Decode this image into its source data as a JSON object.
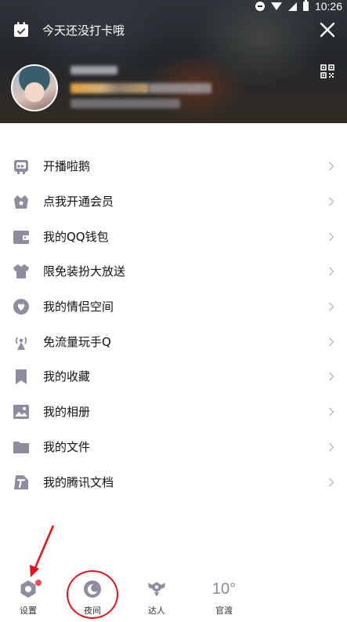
{
  "status_bar": {
    "time": "10:26"
  },
  "header": {
    "checkin_text": "今天还没打卡哦",
    "icons": {
      "checkin": "calendar-check-icon",
      "close": "close-icon",
      "qr": "qr-code-icon"
    }
  },
  "menu": {
    "items": [
      {
        "label": "开播啦鹅",
        "icon": "live-icon"
      },
      {
        "label": "点我开通会员",
        "icon": "vip-icon"
      },
      {
        "label": "我的QQ钱包",
        "icon": "wallet-icon"
      },
      {
        "label": "限免装扮大放送",
        "icon": "dressup-icon"
      },
      {
        "label": "我的情侣空间",
        "icon": "couple-icon"
      },
      {
        "label": "免流量玩手Q",
        "icon": "antenna-icon"
      },
      {
        "label": "我的收藏",
        "icon": "bookmark-icon"
      },
      {
        "label": "我的相册",
        "icon": "album-icon"
      },
      {
        "label": "我的文件",
        "icon": "folder-icon"
      },
      {
        "label": "我的腾讯文档",
        "icon": "docs-icon"
      }
    ]
  },
  "bottom_bar": {
    "settings_label": "设置",
    "night_label": "夜间",
    "expert_label": "达人",
    "weather_temp": "10°",
    "weather_city": "官渡"
  },
  "colors": {
    "icon_gray": "#8d8d9f",
    "badge_red": "#f04a5d",
    "annotation_red": "#e8101b"
  }
}
